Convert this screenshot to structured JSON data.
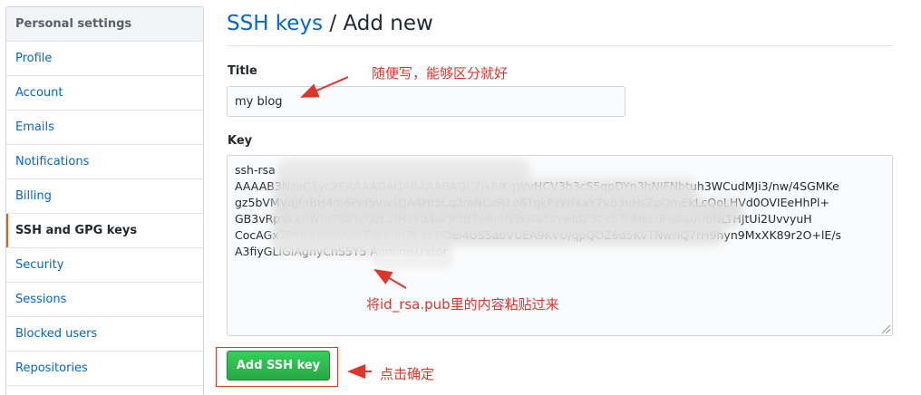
{
  "sidebar": {
    "header": "Personal settings",
    "items": [
      {
        "label": "Profile"
      },
      {
        "label": "Account"
      },
      {
        "label": "Emails"
      },
      {
        "label": "Notifications"
      },
      {
        "label": "Billing"
      },
      {
        "label": "SSH and GPG keys",
        "selected": true
      },
      {
        "label": "Security"
      },
      {
        "label": "Sessions"
      },
      {
        "label": "Blocked users"
      },
      {
        "label": "Repositories"
      }
    ]
  },
  "header": {
    "breadcrumb_link": "SSH keys",
    "separator": " / ",
    "current": "Add new"
  },
  "form": {
    "title_label": "Title",
    "title_value": "my blog",
    "key_label": "Key",
    "key_lines": [
      "ssh-rsa",
      "AAAAB3NzaC1yc2EAAAADAQABAAABAQC7jx8lKqWvHCV3h3cS5qpDYn3hNIFNbtuh3WCudMJi3/nw/4SGMKe",
      "gz5bVMVdJfnBH4m6PeI5VwsQA4Ht5Lq2mNCdR1o8TgkPzWfxaY7vB3uHsZpQmEkLcQoLHVd0OVIEeHhPl+",
      "GB3vRp9kXnWmT8aYcQzL2fHsVd4uPjKtB7eRmN5xGa1sYwIoZ3cVbTnMkLdFg0auU6NLTHJtUi2UvvyuH",
      "CocAGx7PnRwKs2yVmTqL8dJfZb4KNDei4US5abVUEA9KVU/qpQOZ6d5KvTNwrIQ7rH9hyn9MxXK89r2O+lE/s",
      "A3fiyGLIGIAgnyCnS5Y5 Administrator"
    ],
    "submit_label": "Add SSH key"
  },
  "annotations": {
    "title_note": "随便写，能够区分就好",
    "key_note": "将id_rsa.pub里的内容粘贴过来",
    "button_note": "点击确定"
  },
  "colors": {
    "link": "#0366d6",
    "selected_marker": "#e36209",
    "button_green": "#28a745",
    "annotation_red": "#e0352b"
  }
}
